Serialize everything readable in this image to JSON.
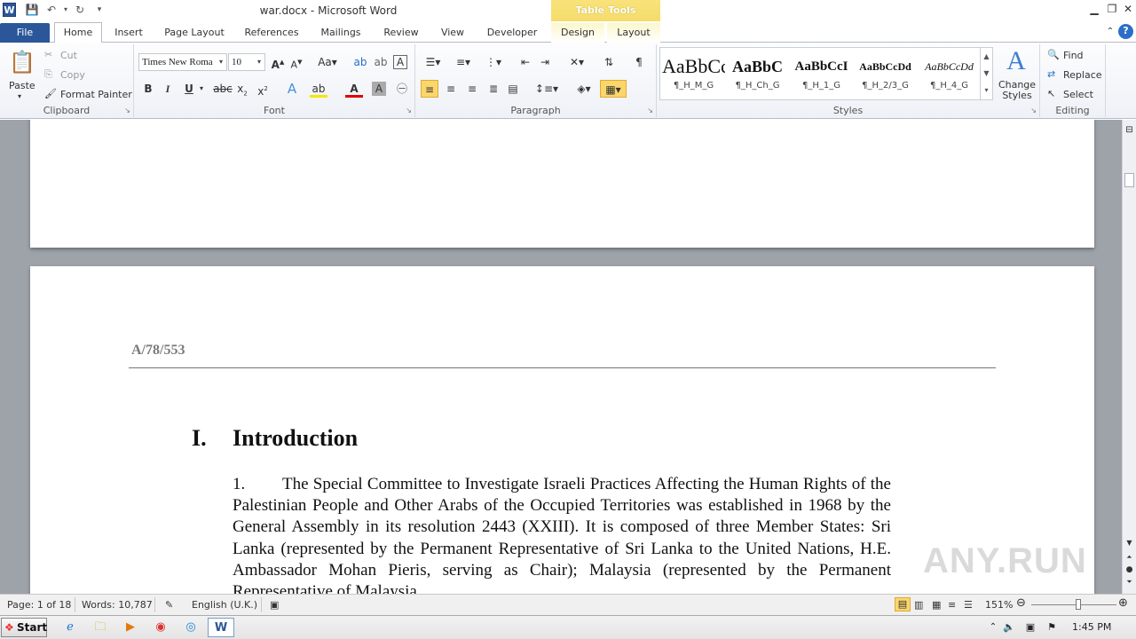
{
  "title_bar": {
    "document_title": "war.docx - Microsoft Word",
    "contextual_group": "Table Tools",
    "app_icon_letter": "W"
  },
  "tabs": [
    "File",
    "Home",
    "Insert",
    "Page Layout",
    "References",
    "Mailings",
    "Review",
    "View",
    "Developer",
    "Design",
    "Layout"
  ],
  "clipboard": {
    "paste": "Paste",
    "cut": "Cut",
    "copy": "Copy",
    "format_painter": "Format Painter",
    "label": "Clipboard"
  },
  "font": {
    "name": "Times New Roma",
    "size": "10",
    "label": "Font"
  },
  "paragraph": {
    "label": "Paragraph"
  },
  "styles": {
    "label": "Styles",
    "items": [
      {
        "preview": "AaBbCc",
        "name": "¶_H_M_G"
      },
      {
        "preview": "AaBbC",
        "name": "¶_H_Ch_G"
      },
      {
        "preview": "AaBbCcI",
        "name": "¶_H_1_G"
      },
      {
        "preview": "AaBbCcDd",
        "name": "¶_H_2/3_G"
      },
      {
        "preview": "AaBbCcDd",
        "name": "¶_H_4_G"
      }
    ],
    "change_styles": "Change Styles"
  },
  "editing": {
    "find": "Find",
    "replace": "Replace",
    "select": "Select",
    "label": "Editing"
  },
  "document": {
    "symbol": "A/78/553",
    "section_number": "I.",
    "section_title": "Introduction",
    "paragraph": "1.        The Special Committee to Investigate Israeli Practices Affecting the Human Rights of the Palestinian People and Other Arabs of the Occupied Territories was established in 1968 by the General Assembly in its resolution 2443 (XXIII). It is composed of three Member States: Sri Lanka (represented by the Permanent Representative of Sri Lanka to the United Nations, H.E. Ambassador Mohan Pieris, serving as Chair); Malaysia (represented by the Permanent Representative of Malaysia"
  },
  "watermark": "ANY.RUN",
  "status": {
    "page": "Page: 1 of 18",
    "words": "Words: 10,787",
    "language": "English (U.K.)",
    "zoom": "151%"
  },
  "taskbar": {
    "start": "Start",
    "time": "1:45 PM"
  },
  "colors": {
    "file_tab": "#2b579a",
    "table_tools": "#f5dc6a",
    "doc_background": "#9ea3aa"
  }
}
